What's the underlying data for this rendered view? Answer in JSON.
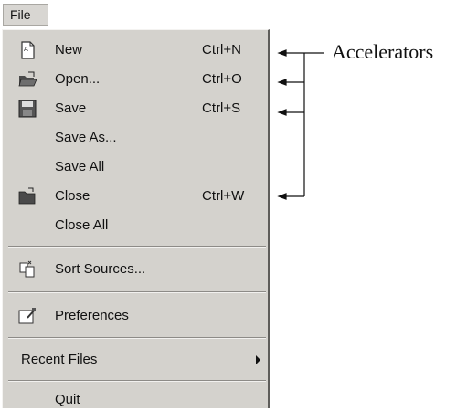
{
  "menubar": {
    "file_label": "File"
  },
  "menu": {
    "new": {
      "label": "New",
      "accel": "Ctrl+N"
    },
    "open": {
      "label": "Open...",
      "accel": "Ctrl+O"
    },
    "save": {
      "label": "Save",
      "accel": "Ctrl+S"
    },
    "save_as": {
      "label": "Save As..."
    },
    "save_all": {
      "label": "Save All"
    },
    "close": {
      "label": "Close",
      "accel": "Ctrl+W"
    },
    "close_all": {
      "label": "Close All"
    },
    "sort_sources": {
      "label": "Sort Sources..."
    },
    "preferences": {
      "label": "Preferences"
    },
    "recent_files": {
      "label": "Recent Files"
    },
    "quit": {
      "label": "Quit"
    }
  },
  "annotation": {
    "label": "Accelerators"
  },
  "icons": {
    "new": "new-document-icon",
    "open": "open-folder-icon",
    "save": "floppy-disk-icon",
    "close": "close-folder-icon",
    "sort_sources": "sort-sources-icon",
    "preferences": "preferences-icon",
    "recent_files_arrow": "chevron-right-icon"
  },
  "colors": {
    "menu_bg": "#d4d2cd",
    "text": "#111111",
    "separator": "#8d8b87"
  }
}
